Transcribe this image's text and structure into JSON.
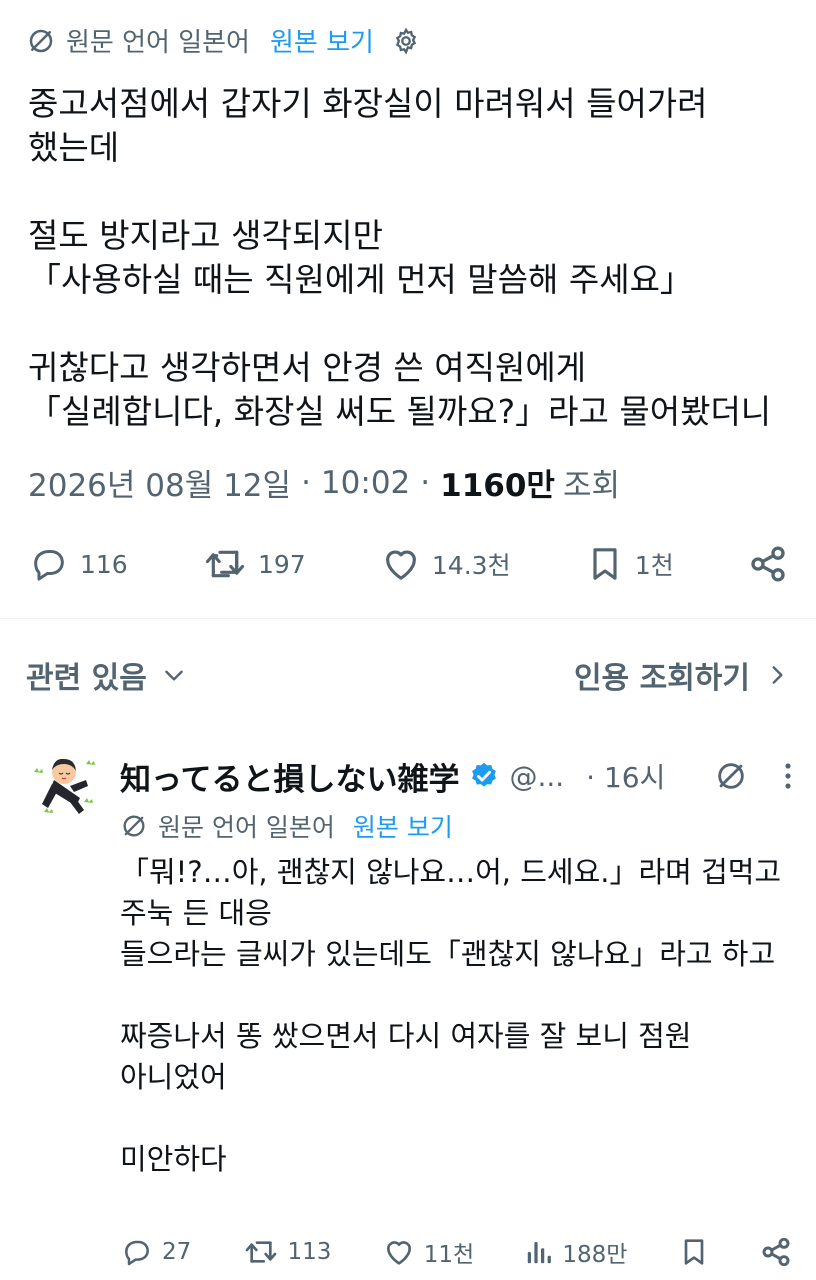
{
  "post": {
    "translation": {
      "label": "원문 언어 일본어",
      "show_original": "원본 보기",
      "icon": "translate-icon",
      "settings_icon": "gear-icon"
    },
    "body": [
      "중고서점에서 갑자기 화장실이 마려워서 들어가려",
      "했는데",
      "",
      "절도 방지라고 생각되지만",
      "「사용하실 때는 직원에게 먼저 말씀해 주세요」",
      "",
      "귀찮다고 생각하면서 안경 쓴 여직원에게",
      "「실례합니다, 화장실 써도 될까요?」라고 물어봤더니"
    ],
    "meta": {
      "date": "2026년 08월 12일",
      "sep1": "·",
      "time": "10:02",
      "sep2": "·",
      "views_count": "1160만",
      "views_label": "조회"
    },
    "actions": {
      "replies": "116",
      "reposts": "197",
      "likes": "14.3천",
      "bookmarks": "1천"
    }
  },
  "related": {
    "label": "관련 있음",
    "quotes_link": "인용 조회하기"
  },
  "reply": {
    "name": "知ってると損しない雑学",
    "handle": "@...",
    "time": "· 16시",
    "translation": {
      "label": "원문 언어 일본어",
      "show_original": "원본 보기"
    },
    "body": [
      "「뭐!?…아, 괜찮지 않나요…어, 드세요.」라며 겁먹고",
      "주눅 든 대응",
      "들으라는 글씨가 있는데도「괜찮지 않나요」라고 하고",
      "",
      "짜증나서 똥 쌌으면서 다시 여자를 잘 보니 점원",
      "아니었어",
      "",
      "미안하다"
    ],
    "actions": {
      "replies": "27",
      "reposts": "113",
      "likes": "11천",
      "views": "188만"
    }
  },
  "colors": {
    "accent": "#1d9bf0",
    "text": "#0f1419",
    "secondary": "#536471",
    "divider": "#eff3f4",
    "verified": "#1d9bf0"
  }
}
